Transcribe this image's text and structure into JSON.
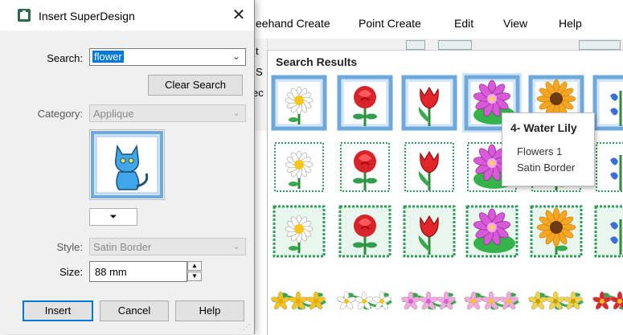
{
  "background_app": {
    "menu": [
      "eehand Create",
      "Point Create",
      "Edit",
      "View",
      "Help"
    ],
    "left_letters": [
      "t",
      "S",
      "ec"
    ]
  },
  "dialog": {
    "title": "Insert SuperDesign",
    "close_glyph": "✕",
    "search": {
      "label": "Search:",
      "value": "flower"
    },
    "clear_search_label": "Clear Search",
    "category": {
      "label": "Category:",
      "value": "Applique"
    },
    "expand_glyph": "⏷",
    "style": {
      "label": "Style:",
      "value": "Satin Border"
    },
    "size": {
      "label": "Size:",
      "value": "88 mm"
    },
    "buttons": {
      "insert": "Insert",
      "cancel": "Cancel",
      "help": "Help"
    }
  },
  "results": {
    "title": "Search Results",
    "rows": [
      {
        "style": "framed",
        "items": [
          "daisy",
          "rose",
          "tulip",
          "water-lily",
          "sunflower",
          "bluebell"
        ]
      },
      {
        "style": "stitched",
        "items": [
          "daisy",
          "rose",
          "tulip",
          "water-lily",
          "sunflower",
          "bluebell"
        ]
      },
      {
        "style": "satin",
        "items": [
          "daisy",
          "rose",
          "tulip",
          "water-lily",
          "sunflower",
          "bluebell"
        ]
      },
      {
        "style": "border",
        "items": [
          "yellow-vine",
          "white-vine",
          "pink-vine",
          "mixed-vine",
          "gold-vine",
          "red-vine"
        ]
      }
    ],
    "selected_index": 3
  },
  "tooltip": {
    "title": "4- Water Lily",
    "line1": "Flowers 1",
    "line2": "Satin Border"
  },
  "colors": {
    "accent": "#0078d7",
    "frame_blue": "#6fa8dc",
    "stitch_green": "#2e9e5b"
  }
}
